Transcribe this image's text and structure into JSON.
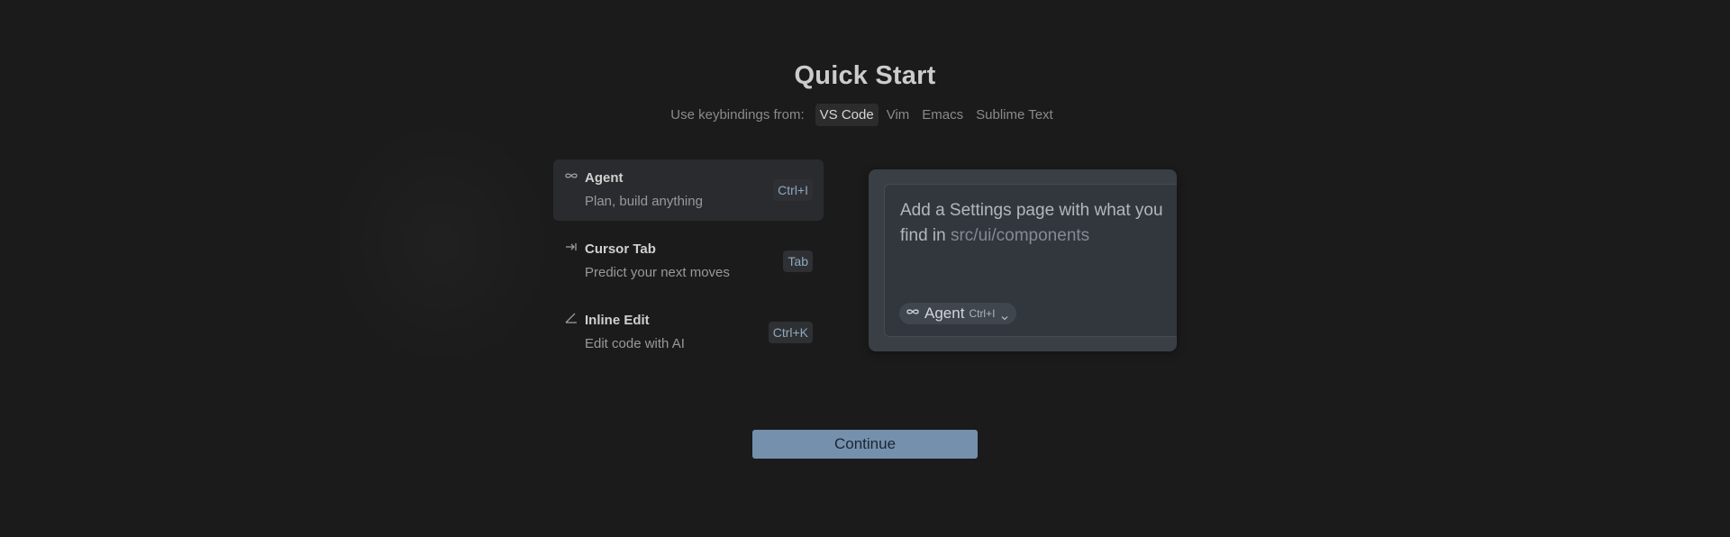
{
  "title": "Quick Start",
  "keybindings": {
    "label": "Use keybindings from:",
    "options": [
      {
        "label": "VS Code",
        "selected": true
      },
      {
        "label": "Vim",
        "selected": false
      },
      {
        "label": "Emacs",
        "selected": false
      },
      {
        "label": "Sublime Text",
        "selected": false
      }
    ]
  },
  "features": [
    {
      "icon": "infinity-icon",
      "title": "Agent",
      "description": "Plan, build anything",
      "shortcut": "Ctrl+I",
      "active": true
    },
    {
      "icon": "tab-arrow-icon",
      "title": "Cursor Tab",
      "description": "Predict your next moves",
      "shortcut": "Tab",
      "active": false
    },
    {
      "icon": "edit-angle-icon",
      "title": "Inline Edit",
      "description": "Edit code with AI",
      "shortcut": "Ctrl+K",
      "active": false
    }
  ],
  "preview": {
    "prompt_text": "Add a Settings page with what you find in ",
    "prompt_path": "src/ui/components",
    "mode_label": "Agent",
    "mode_shortcut": "Ctrl+I"
  },
  "continue_label": "Continue",
  "colors": {
    "background": "#1b1b1b",
    "accent_button": "#7590ad",
    "shortcut_text": "#8fa9c0"
  }
}
